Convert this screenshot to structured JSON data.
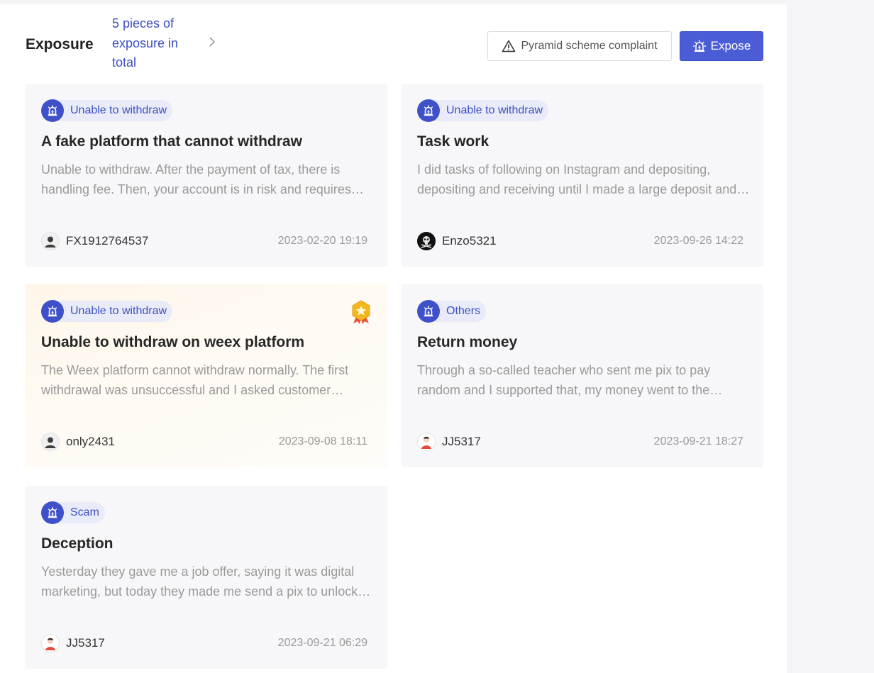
{
  "header": {
    "title": "Exposure",
    "count_text": "5 pieces of exposure in total",
    "complaint_button": "Pyramid scheme complaint",
    "expose_button": "Expose"
  },
  "icons": {
    "tag": "alarm-siren-icon",
    "warning": "warning-triangle-icon",
    "chevron": "chevron-right-icon",
    "featured": "gold-star-badge-icon"
  },
  "colors": {
    "accent": "#4a5dd6",
    "tag_text": "#3d4fc4",
    "tag_bg": "#e9ecf8",
    "card_bg": "#f7f7f9",
    "featured_bg": "#fff6e9"
  },
  "cards": [
    {
      "tag": "Unable to withdraw",
      "title": "A fake platform that cannot withdraw",
      "description": "Unable to withdraw. After the payment of tax, there is handling fee. Then, your account is in risk and requires further verification payments before any withdrawal.",
      "author": "FX1912764537",
      "date": "2023-02-20 19:19",
      "avatar": "default-user",
      "featured": false
    },
    {
      "tag": "Unable to withdraw",
      "title": "Task work",
      "description": "I did tasks of following on Instagram and depositing, depositing and receiving until I made a large deposit and could not withdraw anymore.",
      "author": "Enzo5321",
      "date": "2023-09-26 14:22",
      "avatar": "skull-dark",
      "featured": false
    },
    {
      "tag": "Unable to withdraw",
      "title": "Unable to withdraw on weex platform",
      "description": "The Weex platform cannot withdraw normally. The first withdrawal was unsuccessful and I asked customer service for help many times.",
      "author": "only2431",
      "date": "2023-09-08 18:11",
      "avatar": "default-user",
      "featured": true
    },
    {
      "tag": "Others",
      "title": "Return money",
      "description": "Through a so-called teacher who sent me pix to pay random and I supported that, my money went to the scammers and never came back.",
      "author": "JJ5317",
      "date": "2023-09-21 18:27",
      "avatar": "red-person",
      "featured": false
    },
    {
      "tag": "Scam",
      "title": "Deception",
      "description": "Yesterday they gave me a job offer, saying it was digital marketing, but today they made me send a pix to unlock the tasks.",
      "author": "JJ5317",
      "date": "2023-09-21 06:29",
      "avatar": "red-person",
      "featured": false
    }
  ]
}
